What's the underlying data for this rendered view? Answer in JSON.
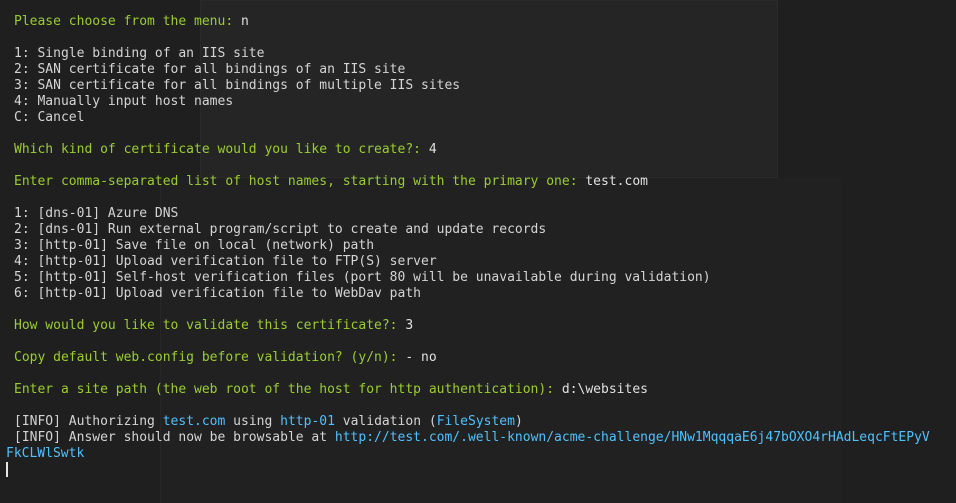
{
  "menu_prompt": {
    "question": "Please choose from the menu:",
    "answer": " n"
  },
  "menu_options": [
    "1: Single binding of an IIS site",
    "2: SAN certificate for all bindings of an IIS site",
    "3: SAN certificate for all bindings of multiple IIS sites",
    "4: Manually input host names",
    "C: Cancel"
  ],
  "cert_prompt": {
    "question": "Which kind of certificate would you like to create?:",
    "answer": " 4"
  },
  "host_prompt": {
    "question": "Enter comma-separated list of host names, starting with the primary one:",
    "answer": " test.com"
  },
  "validation_options": [
    "1: [dns-01] Azure DNS",
    "2: [dns-01] Run external program/script to create and update records",
    "3: [http-01] Save file on local (network) path",
    "4: [http-01] Upload verification file to FTP(S) server",
    "5: [http-01] Self-host verification files (port 80 will be unavailable during validation)",
    "6: [http-01] Upload verification file to WebDav path"
  ],
  "validate_prompt": {
    "question": "How would you like to validate this certificate?:",
    "answer": " 3"
  },
  "webconfig_prompt": {
    "question": "Copy default web.config before validation? (y/n):",
    "answer": " - no"
  },
  "sitepath_prompt": {
    "question": "Enter a site path (the web root of the host for http authentication):",
    "answer": " d:\\websites"
  },
  "log1": {
    "tag": "[INFO]",
    "p1": " Authorizing ",
    "host": "test.com",
    "p2": " using ",
    "method": "http-01",
    "p3": " validation (",
    "plugin": "FileSystem",
    "p4": ")"
  },
  "log2": {
    "tag": "[INFO]",
    "p1": " Answer should now be browsable at ",
    "url": "http://test.com/.well-known/acme-challenge/HNw1MqqqaE6j47bOXO4rHAdLeqcFtEPyV",
    "url_wrap": "FkCLWlSwtk"
  },
  "colors": {
    "background": "#1f1f1f",
    "prompt": "#9acd32",
    "text": "#d4d4d4",
    "link": "#4fc1ff"
  }
}
